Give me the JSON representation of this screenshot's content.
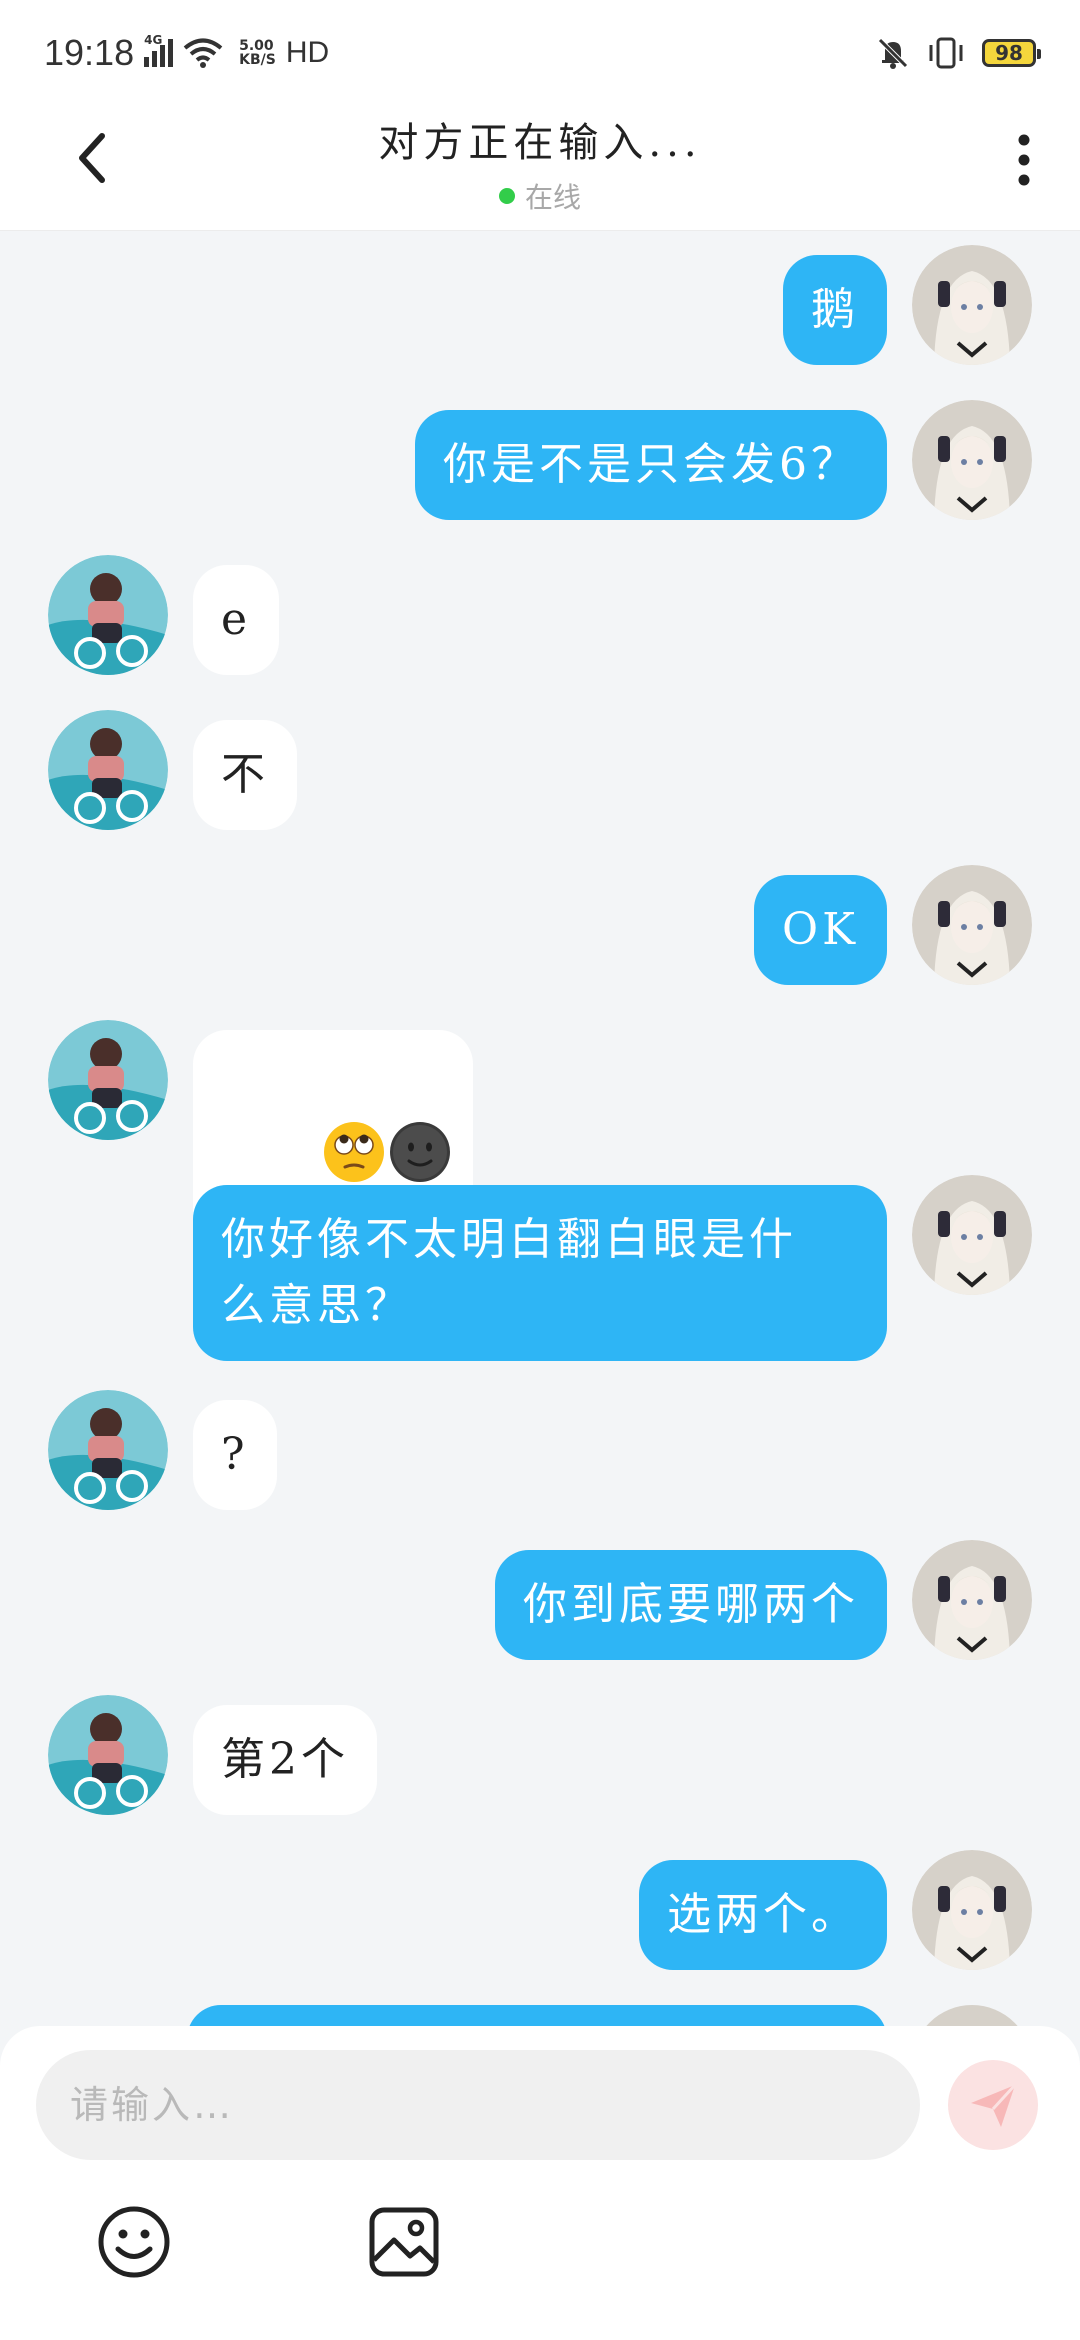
{
  "status_bar": {
    "time": "19:18",
    "network_type": "4G",
    "speed_value": "5.00",
    "speed_unit": "KB/S",
    "hd_label": "HD",
    "battery": "98"
  },
  "header": {
    "title": "对方正在输入...",
    "status": "在线"
  },
  "messages": [
    {
      "side": "right",
      "text": "鹅"
    },
    {
      "side": "right",
      "text": "你是不是只会发6？"
    },
    {
      "side": "left",
      "text": "e"
    },
    {
      "side": "left",
      "text": "不"
    },
    {
      "side": "right",
      "text": "OK"
    },
    {
      "side": "left",
      "text": "",
      "emojis": [
        "face-with-rolling-eyes",
        "new-moon-face"
      ]
    },
    {
      "side": "right",
      "text": "你好像不太明白翻白眼是什\n么意思？"
    },
    {
      "side": "left",
      "text": "?"
    },
    {
      "side": "right",
      "text": "你到底要哪两个"
    },
    {
      "side": "left",
      "text": "第2个"
    },
    {
      "side": "right",
      "text": "选两个。"
    }
  ],
  "input": {
    "placeholder": "请输入…"
  },
  "colors": {
    "outgoing_bubble": "#2eb5f5",
    "incoming_bubble": "#ffffff",
    "background": "#f3f5f7",
    "online_dot": "#32cd4a"
  }
}
